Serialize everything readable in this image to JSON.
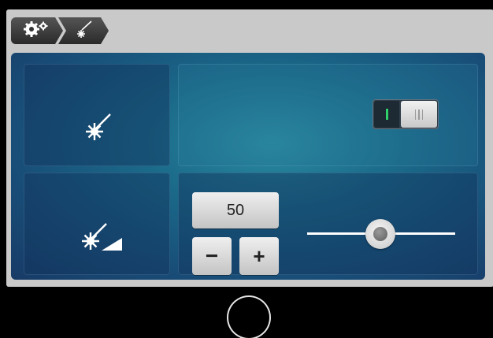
{
  "breadcrumb": {
    "items": [
      {
        "icon": "gears-icon"
      },
      {
        "icon": "laser-icon"
      }
    ]
  },
  "laser_toggle": {
    "on_label": "I",
    "off_label": "III",
    "state": "off"
  },
  "laser_power": {
    "value": "50",
    "minus_label": "−",
    "plus_label": "+",
    "slider_level": 0.5
  },
  "colors": {
    "panel_bg": "#1b6a8a",
    "frame": "#c9c9c9",
    "toggle_on_indicator": "#2fd26a"
  },
  "nav": {
    "home_icon": "home-circle-icon"
  }
}
